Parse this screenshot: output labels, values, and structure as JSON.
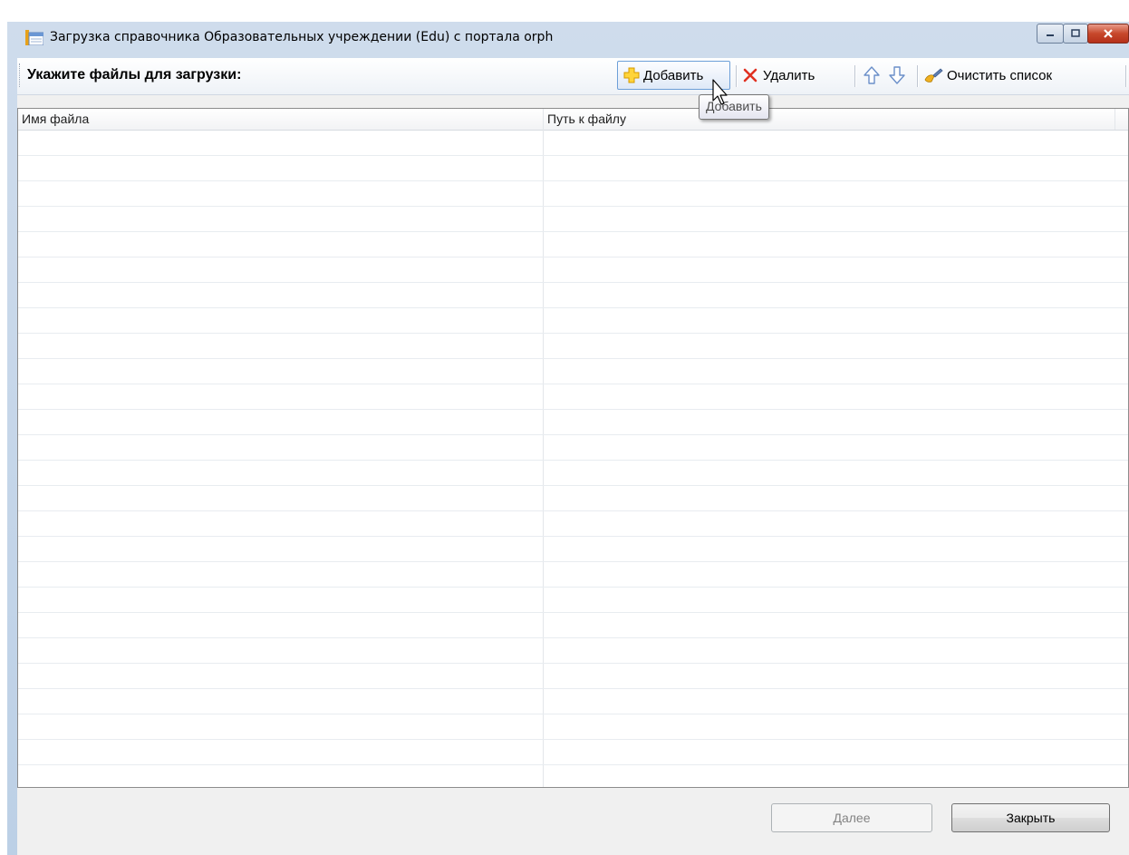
{
  "window": {
    "title": "Загрузка справочника Образовательных учреждении (Edu) с портала orph",
    "buttons": {
      "minimize": "minimize",
      "maximize": "maximize",
      "close": "close"
    }
  },
  "toolbar": {
    "label": "Укажите файлы для загрузки:",
    "add_label": "Добавить",
    "delete_label": "Удалить",
    "clear_label": "Очистить список",
    "icons": {
      "add": "plus-icon",
      "delete": "x-icon",
      "up": "arrow-up-icon",
      "down": "arrow-down-icon",
      "clear": "brush-icon"
    },
    "colors": {
      "add": "#f2b100",
      "delete": "#e03020",
      "arrows": "#6b8fc9"
    }
  },
  "table": {
    "columns": [
      "Имя файла",
      "Путь к файлу"
    ],
    "rows": []
  },
  "tooltip": {
    "text": "Добавить"
  },
  "footer": {
    "next_label": "Далее",
    "close_label": "Закрыть"
  }
}
